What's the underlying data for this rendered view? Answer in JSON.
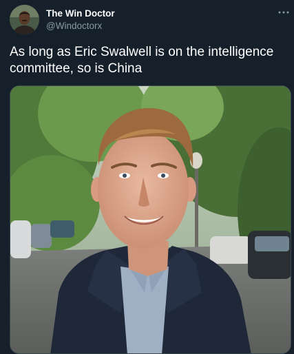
{
  "tweet": {
    "author": {
      "display_name": "The Win Doctor",
      "handle": "@Windoctorx",
      "avatar_icon": "profile-photo"
    },
    "more_icon": "more-horizontal-icon",
    "text": "As long as Eric Swalwell is on the intelligence committee, so is China",
    "media": {
      "kind": "photo"
    }
  },
  "colors": {
    "background": "#15202b",
    "primary_text": "#ffffff",
    "secondary_text": "#8b98a5"
  }
}
